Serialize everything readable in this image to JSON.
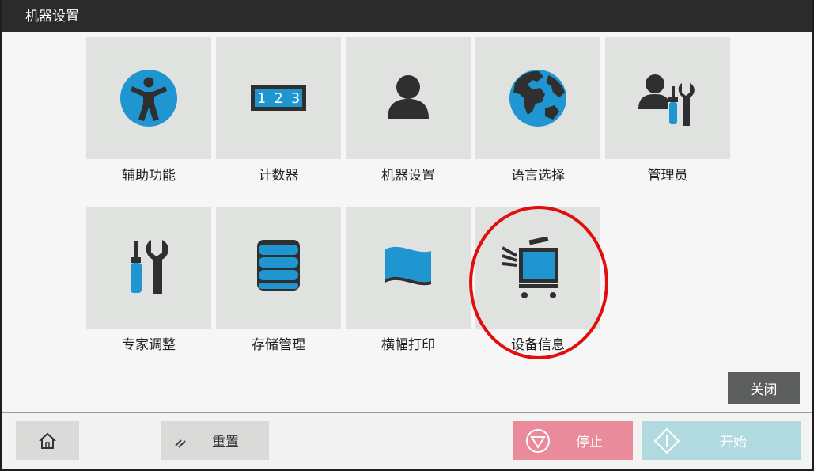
{
  "window": {
    "title": "机器设置"
  },
  "tiles_row1": [
    {
      "label": "辅助功能",
      "icon": "accessibility-icon"
    },
    {
      "label": "计数器",
      "icon": "counter-icon",
      "counter_text": "1 2 3"
    },
    {
      "label": "机器设置",
      "icon": "user-icon"
    },
    {
      "label": "语言选择",
      "icon": "globe-icon"
    },
    {
      "label": "管理员",
      "icon": "administrator-icon"
    }
  ],
  "tiles_row2": [
    {
      "label": "专家调整",
      "icon": "tools-icon"
    },
    {
      "label": "存储管理",
      "icon": "storage-icon"
    },
    {
      "label": "横幅打印",
      "icon": "banner-icon"
    },
    {
      "label": "设备信息",
      "icon": "device-info-icon",
      "highlighted": true
    }
  ],
  "actions": {
    "close_label": "关闭"
  },
  "bottom_bar": {
    "home_icon": "home-icon",
    "reset_label": "重置",
    "stop_label": "停止",
    "start_label": "开始"
  },
  "colors": {
    "accent_blue": "#1f95d1",
    "icon_dark": "#2f2f2f",
    "tile_bg": "#e0e2df",
    "highlight_circle": "#e10e0e",
    "stop_bg": "#e98b9b",
    "start_bg": "#b1d9e0"
  }
}
